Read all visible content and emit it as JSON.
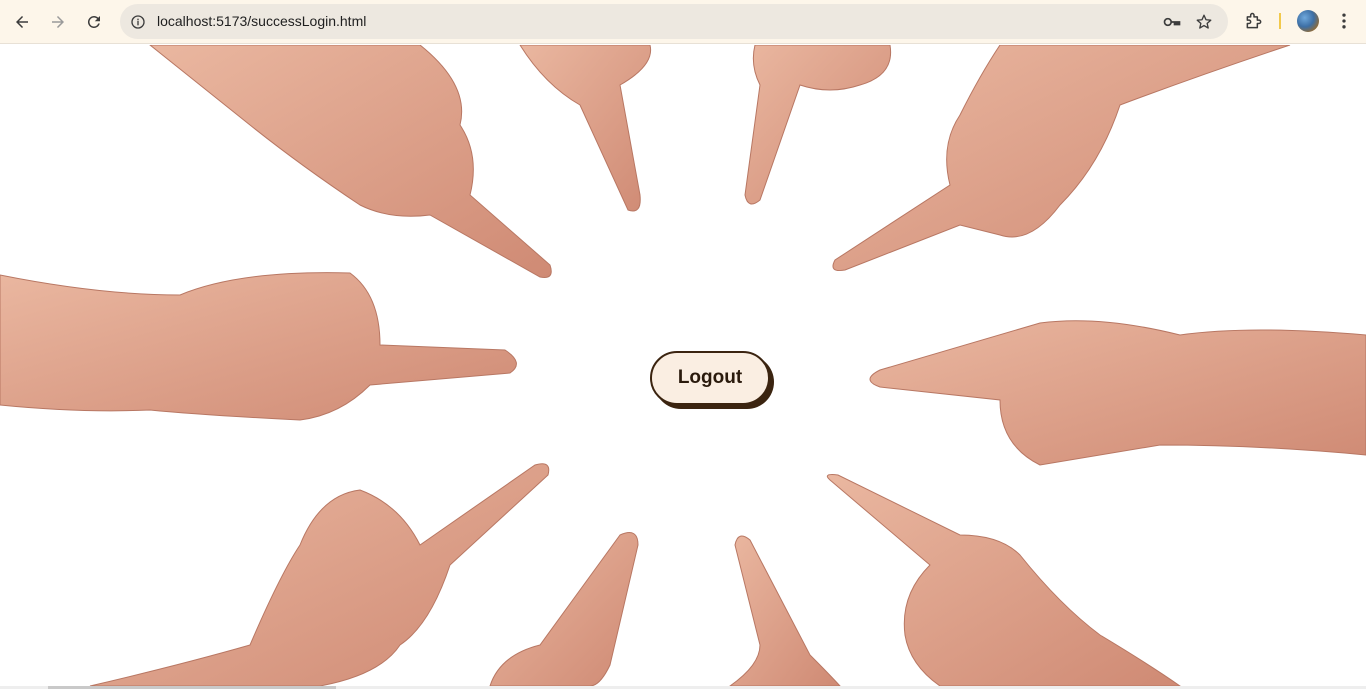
{
  "browser": {
    "url": "localhost:5173/successLogin.html",
    "icons": {
      "back": "arrow-left-icon",
      "forward": "arrow-right-icon",
      "reload": "reload-icon",
      "site_info": "info-circle-icon",
      "password": "key-icon",
      "bookmark": "star-icon",
      "extensions": "puzzle-piece-icon",
      "profile": "avatar",
      "menu": "kebab-menu-icon"
    }
  },
  "page": {
    "logout_label": "Logout",
    "background": "pointing-hands-image",
    "colors": {
      "button_bg": "#faeee2",
      "button_border": "#3b2410",
      "skin": "#e0a38c"
    }
  }
}
